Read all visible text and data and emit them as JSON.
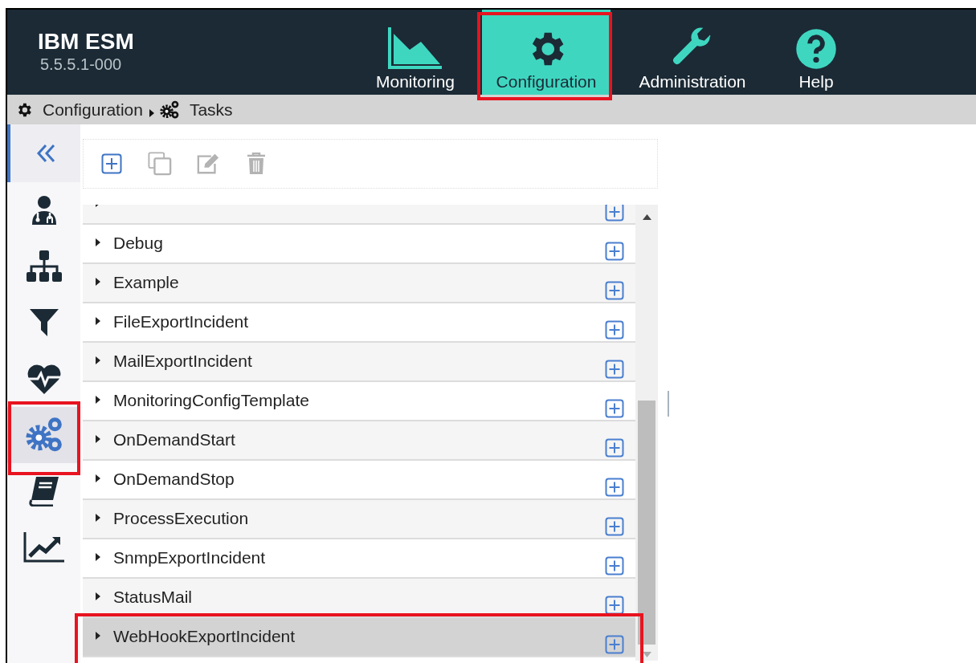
{
  "app": {
    "title": "IBM ESM",
    "version": "5.5.5.1-000"
  },
  "nav": [
    {
      "label": "Monitoring",
      "kind": "chart",
      "selected": false,
      "highlighted": false
    },
    {
      "label": "Configuration",
      "kind": "gear",
      "selected": true,
      "highlighted": true
    },
    {
      "label": "Administration",
      "kind": "wrench",
      "selected": false,
      "highlighted": false
    },
    {
      "label": "Help",
      "kind": "help",
      "selected": false,
      "highlighted": false
    }
  ],
  "breadcrumb": [
    {
      "label": "Configuration",
      "kind": "gear"
    },
    {
      "label": "Tasks",
      "kind": "gears"
    }
  ],
  "sidebar": [
    {
      "kind": "doctor",
      "selected": false,
      "highlighted": false
    },
    {
      "kind": "hierarchy",
      "selected": false,
      "highlighted": false
    },
    {
      "kind": "filter",
      "selected": false,
      "highlighted": false
    },
    {
      "kind": "heartbeat",
      "selected": false,
      "highlighted": false
    },
    {
      "kind": "gears",
      "selected": true,
      "highlighted": true
    },
    {
      "kind": "book",
      "selected": false,
      "highlighted": false
    },
    {
      "kind": "trend",
      "selected": false,
      "highlighted": false
    }
  ],
  "toolbar": [
    {
      "kind": "add",
      "disabled": false
    },
    {
      "kind": "copy",
      "disabled": true
    },
    {
      "kind": "edit",
      "disabled": true
    },
    {
      "kind": "delete",
      "disabled": true
    }
  ],
  "tasks": [
    {
      "selected": false,
      "highlighted": false
    },
    {
      "name": "Debug",
      "selected": false,
      "highlighted": false
    },
    {
      "name": "Example",
      "selected": false,
      "highlighted": false
    },
    {
      "name": "FileExportIncident",
      "selected": false,
      "highlighted": false
    },
    {
      "name": "MailExportIncident",
      "selected": false,
      "highlighted": false
    },
    {
      "name": "MonitoringConfigTemplate",
      "selected": false,
      "highlighted": false
    },
    {
      "name": "OnDemandStart",
      "selected": false,
      "highlighted": false
    },
    {
      "name": "OnDemandStop",
      "selected": false,
      "highlighted": false
    },
    {
      "name": "ProcessExecution",
      "selected": false,
      "highlighted": false
    },
    {
      "name": "SnmpExportIncident",
      "selected": false,
      "highlighted": false
    },
    {
      "name": "StatusMail",
      "selected": false,
      "highlighted": false
    },
    {
      "name": "WebHookExportIncident",
      "selected": true,
      "highlighted": true
    }
  ]
}
